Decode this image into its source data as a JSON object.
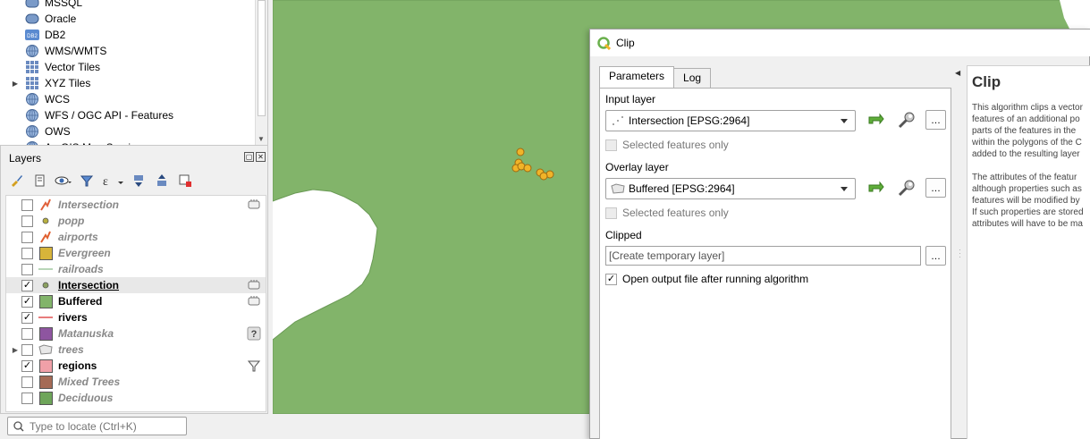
{
  "browser": {
    "items": [
      {
        "label": "MSSQL",
        "icon": "mssql-icon",
        "expandable": false
      },
      {
        "label": "Oracle",
        "icon": "oracle-icon",
        "expandable": false
      },
      {
        "label": "DB2",
        "icon": "db2-icon",
        "icon_text": "DB2",
        "expandable": false
      },
      {
        "label": "WMS/WMTS",
        "icon": "globe-icon",
        "expandable": false
      },
      {
        "label": "Vector Tiles",
        "icon": "grid-icon",
        "expandable": false
      },
      {
        "label": "XYZ Tiles",
        "icon": "grid-icon",
        "expandable": true
      },
      {
        "label": "WCS",
        "icon": "globe-icon",
        "expandable": false
      },
      {
        "label": "WFS / OGC API - Features",
        "icon": "globe-icon",
        "expandable": false
      },
      {
        "label": "OWS",
        "icon": "globe-icon",
        "expandable": false
      },
      {
        "label": "ArcGIS Map Service",
        "icon": "globe-icon",
        "expandable": false
      }
    ]
  },
  "layers_panel": {
    "title": "Layers",
    "layers": [
      {
        "name": "Intersection",
        "checked": false,
        "visible_style": "off",
        "symbol": "line-star",
        "color": "#e0603a",
        "indicator": "embedded"
      },
      {
        "name": "popp",
        "checked": false,
        "visible_style": "off",
        "symbol": "point",
        "color": "#b8b040",
        "indicator": ""
      },
      {
        "name": "airports",
        "checked": false,
        "visible_style": "off",
        "symbol": "line-star",
        "color": "#e06030",
        "indicator": ""
      },
      {
        "name": "Evergreen",
        "checked": false,
        "visible_style": "off",
        "symbol": "fill",
        "color": "#d7b43a",
        "indicator": ""
      },
      {
        "name": "railroads",
        "checked": false,
        "visible_style": "off",
        "symbol": "line",
        "color": "#a0c8a0",
        "indicator": ""
      },
      {
        "name": "Intersection",
        "checked": true,
        "visible_style": "on-ul",
        "symbol": "point",
        "color": "#8aa060",
        "indicator": "embedded",
        "selected": true
      },
      {
        "name": "Buffered",
        "checked": true,
        "visible_style": "on",
        "symbol": "fill",
        "color": "#82b46a",
        "indicator": "embedded"
      },
      {
        "name": "rivers",
        "checked": true,
        "visible_style": "on",
        "symbol": "line",
        "color": "#e05050",
        "indicator": ""
      },
      {
        "name": "Matanuska",
        "checked": false,
        "visible_style": "off",
        "symbol": "fill",
        "color": "#8e55a0",
        "indicator": "help"
      },
      {
        "name": "trees",
        "checked": false,
        "visible_style": "off",
        "symbol": "group",
        "color": "#c8c8c8",
        "indicator": "",
        "expandable": true
      },
      {
        "name": "regions",
        "checked": true,
        "visible_style": "on",
        "symbol": "fill",
        "color": "#f0a0a8",
        "indicator": "filter"
      },
      {
        "name": "Mixed Trees",
        "checked": false,
        "visible_style": "off",
        "symbol": "fill",
        "color": "#a56a55",
        "indicator": ""
      },
      {
        "name": "Deciduous",
        "checked": false,
        "visible_style": "off",
        "symbol": "fill",
        "color": "#6ea55a",
        "indicator": ""
      }
    ]
  },
  "locator": {
    "placeholder": "Type to locate (Ctrl+K)"
  },
  "map": {
    "fill_color": "#82b46a"
  },
  "dialog": {
    "title": "Clip",
    "tabs": [
      {
        "label": "Parameters",
        "active": true
      },
      {
        "label": "Log",
        "active": false
      }
    ],
    "input_layer": {
      "label": "Input layer",
      "value": "Intersection [EPSG:2964]",
      "selected_only_label": "Selected features only"
    },
    "overlay_layer": {
      "label": "Overlay layer",
      "value": "Buffered [EPSG:2964]",
      "selected_only_label": "Selected features only"
    },
    "clipped": {
      "label": "Clipped",
      "placeholder": "[Create temporary layer]"
    },
    "open_output": {
      "label": "Open output file after running algorithm",
      "checked": true
    },
    "ellipsis_label": "…",
    "help": {
      "title": "Clip",
      "paragraph1": [
        "This algorithm clips a vector",
        "features of an additional po",
        "parts of the features in the",
        "within the polygons of the C",
        "added to the resulting layer"
      ],
      "paragraph2": [
        "The attributes of the featur",
        "although properties such as",
        "features will be modified by",
        "If such properties are stored",
        "attributes will have to be ma"
      ]
    }
  }
}
